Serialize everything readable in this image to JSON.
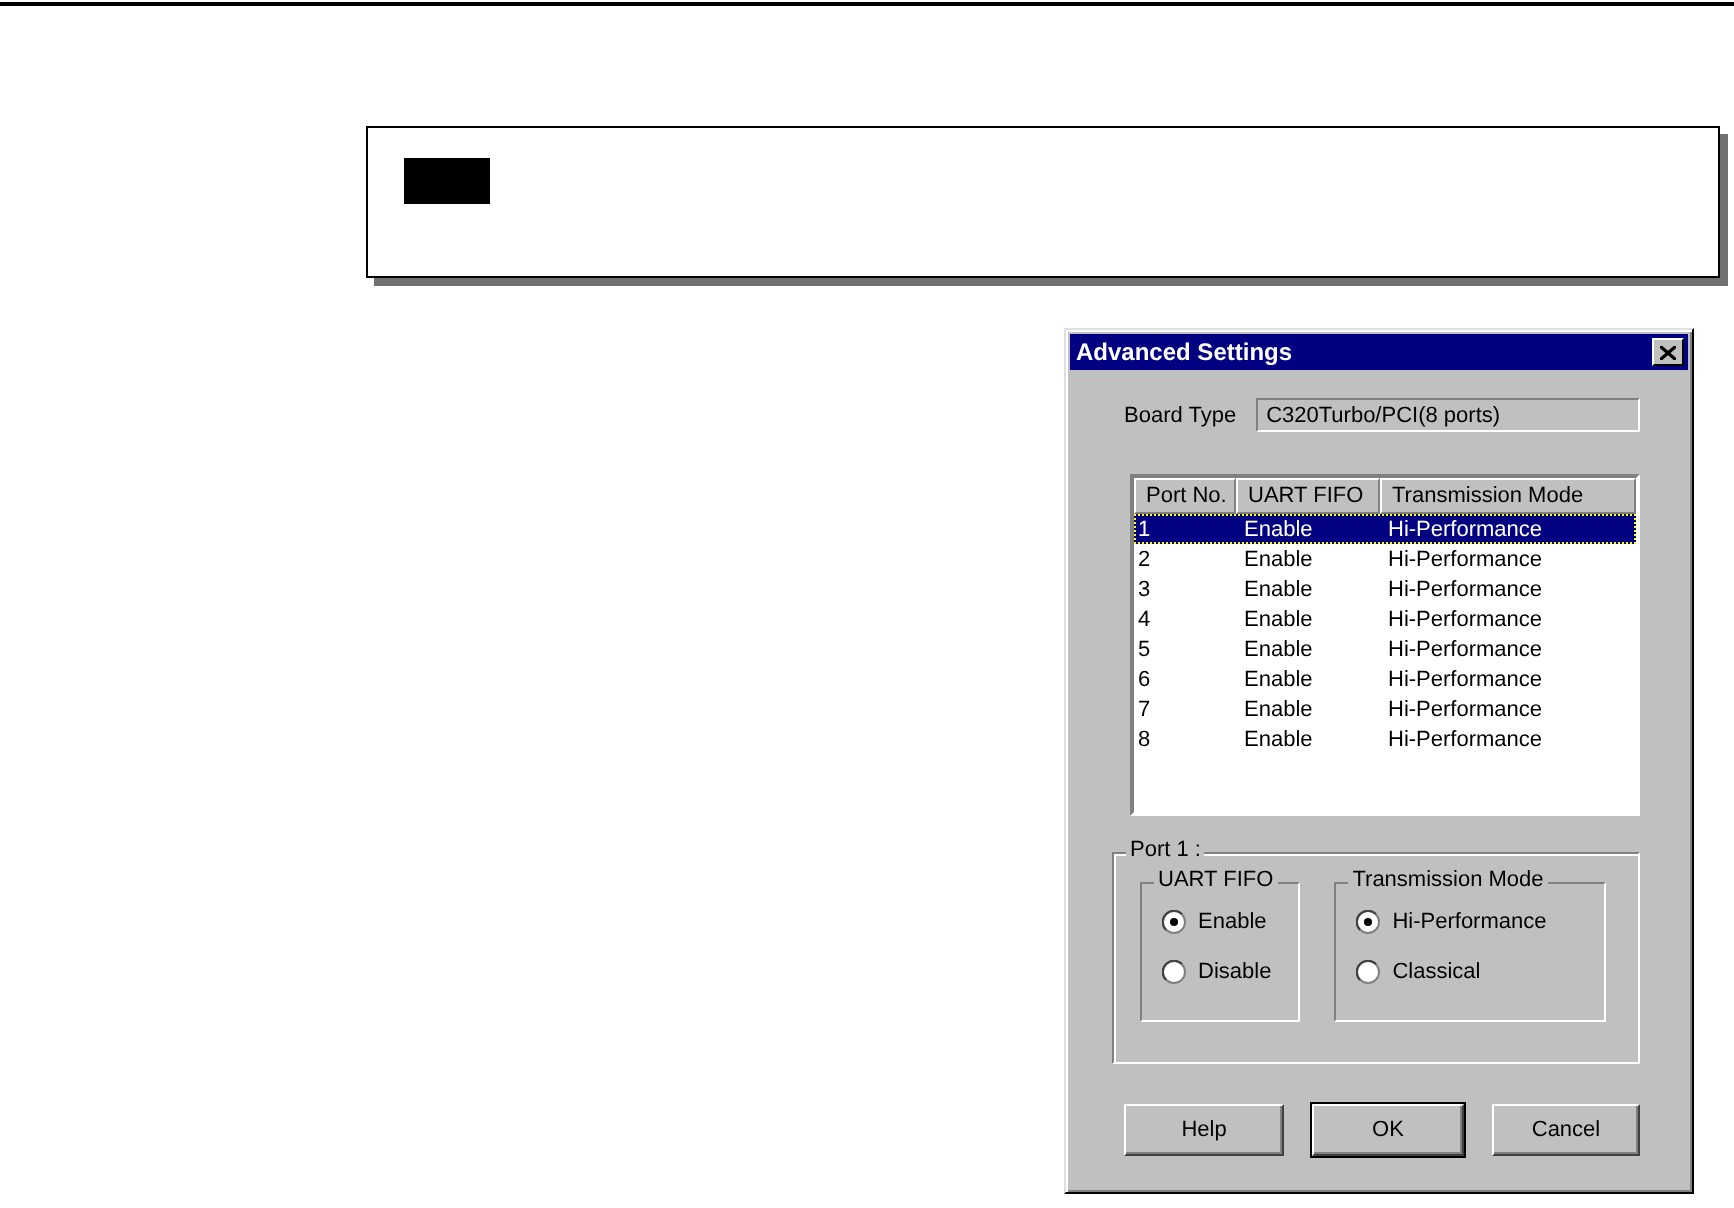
{
  "dialog": {
    "title": "Advanced Settings",
    "board_type": {
      "label": "Board Type",
      "value": "C320Turbo/PCI(8 ports)"
    },
    "port_table": {
      "columns": [
        "Port No.",
        "UART FIFO",
        "Transmission Mode"
      ],
      "rows": [
        {
          "cells": [
            "1",
            "Enable",
            "Hi-Performance"
          ],
          "selected": true
        },
        {
          "cells": [
            "2",
            "Enable",
            "Hi-Performance"
          ],
          "selected": false
        },
        {
          "cells": [
            "3",
            "Enable",
            "Hi-Performance"
          ],
          "selected": false
        },
        {
          "cells": [
            "4",
            "Enable",
            "Hi-Performance"
          ],
          "selected": false
        },
        {
          "cells": [
            "5",
            "Enable",
            "Hi-Performance"
          ],
          "selected": false
        },
        {
          "cells": [
            "6",
            "Enable",
            "Hi-Performance"
          ],
          "selected": false
        },
        {
          "cells": [
            "7",
            "Enable",
            "Hi-Performance"
          ],
          "selected": false
        },
        {
          "cells": [
            "8",
            "Enable",
            "Hi-Performance"
          ],
          "selected": false
        }
      ]
    },
    "port_group": {
      "title": "Port 1 :",
      "groups": [
        {
          "title": "UART FIFO",
          "options": [
            {
              "label": "Enable",
              "selected": true
            },
            {
              "label": "Disable",
              "selected": false
            }
          ]
        },
        {
          "title": "Transmission Mode",
          "options": [
            {
              "label": "Hi-Performance",
              "selected": true
            },
            {
              "label": "Classical",
              "selected": false
            }
          ]
        }
      ]
    },
    "buttons": [
      {
        "label": "Help",
        "default": false
      },
      {
        "label": "OK",
        "default": true
      },
      {
        "label": "Cancel",
        "default": false
      }
    ]
  }
}
